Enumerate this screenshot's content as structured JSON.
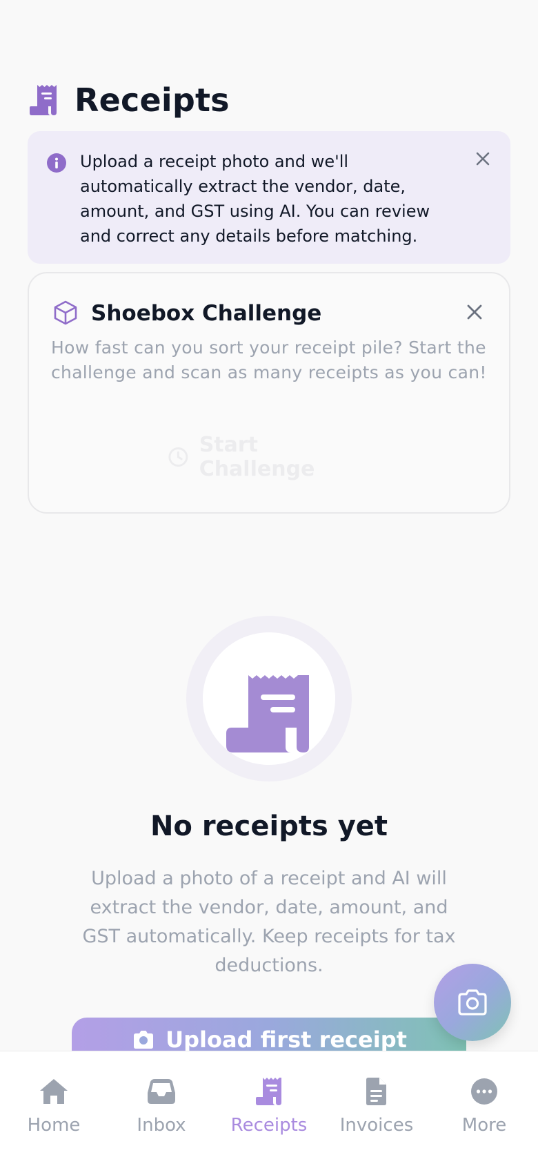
{
  "header": {
    "title": "Receipts",
    "icon": "receipt-icon"
  },
  "info_banner": {
    "text": "Upload a receipt photo and we'll automatically extract the vendor, date, amount, and GST using AI. You can review and correct any details before matching.",
    "icon": "info-icon",
    "close_icon": "close-icon"
  },
  "challenge": {
    "title": "Shoebox Challenge",
    "description": "How fast can you sort your receipt pile? Start the challenge and scan as many receipts as you can!",
    "button_label": "Start Challenge",
    "icon": "cube-icon",
    "close_icon": "close-icon"
  },
  "empty_state": {
    "title": "No receipts yet",
    "description": "Upload a photo of a receipt and AI will extract the vendor, date, amount, and GST automatically. Keep receipts for tax deductions.",
    "button_label": "Upload first receipt"
  },
  "fab": {
    "icon": "camera-icon"
  },
  "nav": {
    "items": [
      {
        "label": "Home",
        "icon": "home-icon"
      },
      {
        "label": "Inbox",
        "icon": "inbox-icon"
      },
      {
        "label": "Receipts",
        "icon": "receipt-icon",
        "active": true
      },
      {
        "label": "Invoices",
        "icon": "document-icon"
      },
      {
        "label": "More",
        "icon": "more-icon"
      }
    ]
  },
  "colors": {
    "accent": "#a98bdf",
    "icon_purple": "#8f6cc9",
    "banner_bg": "#efecf8",
    "nav_inactive": "#9ca3af",
    "gradient_start": "#b39fe6",
    "gradient_end": "#7fc2b4"
  }
}
